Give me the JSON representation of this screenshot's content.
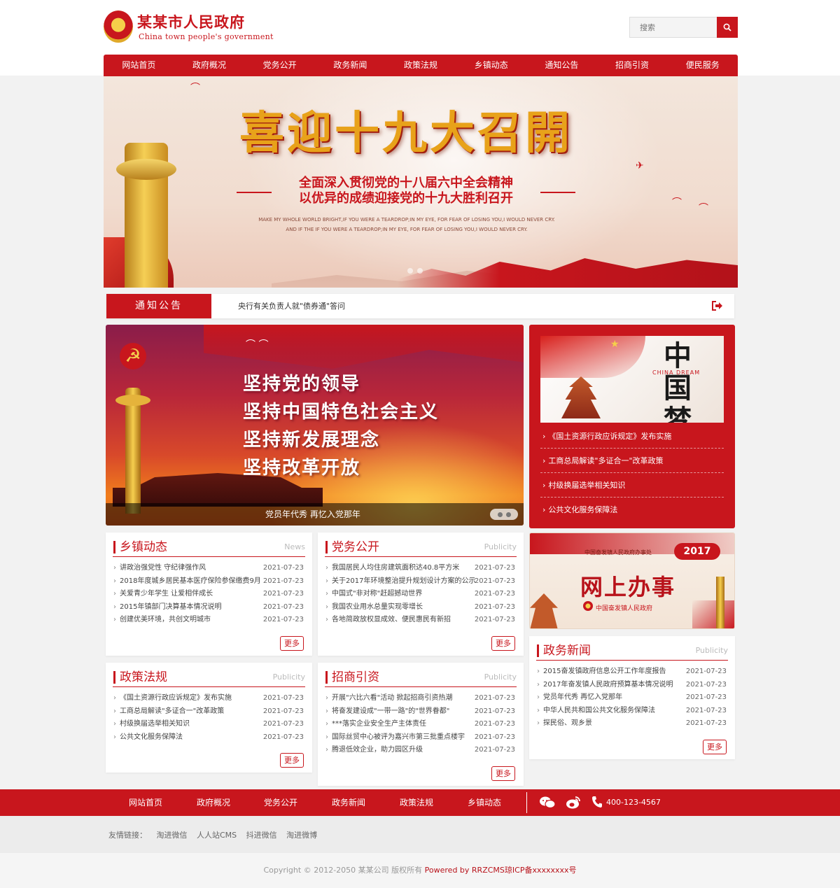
{
  "header": {
    "title": "某某市人民政府",
    "subtitle": "China town people's government",
    "search_placeholder": "搜索"
  },
  "nav": [
    "网站首页",
    "政府概况",
    "党务公开",
    "政务新闻",
    "政策法规",
    "乡镇动态",
    "通知公告",
    "招商引资",
    "便民服务"
  ],
  "banner": {
    "title": "喜迎十九大召開",
    "line1": "全面深入贯彻党的十八届六中全会精神",
    "line2": "以优异的成绩迎接党的十九大胜利召开",
    "en1": "MAKE MY WHOLE WORLD BRIGHT,IF YOU WERE A TEARDROP;IN MY EYE, FOR FEAR OF LOSING YOU,I WOULD NEVER CRY.",
    "en2": "AND IF THE IF YOU WERE A TEARDROP;IN MY EYE, FOR FEAR OF LOSING YOU,I WOULD NEVER CRY."
  },
  "notice": {
    "label": "通知公告",
    "text": "央行有关负责人就\"债券通\"答问"
  },
  "slider": {
    "slogans": [
      "坚持党的领导",
      "坚持中国特色社会主义",
      "坚持新发展理念",
      "坚持改革开放"
    ],
    "caption": "党员年代秀 再忆入党那年"
  },
  "right_box": {
    "image_text": "中国梦",
    "image_en": "CHINA DREAM",
    "items": [
      "《国土资源行政应诉规定》发布实施",
      "工商总局解读\"多证合一\"改革政策",
      "村级换届选举相关知识",
      "公共文化服务保障法"
    ]
  },
  "online": {
    "org": "中国奋发镇人民政府办事处",
    "year": "2017",
    "title": "网上办事",
    "gov": "中国奋发镇人民政府"
  },
  "boxes": {
    "township": {
      "title": "乡镇动态",
      "en": "News",
      "more": "更多",
      "items": [
        {
          "t": "讲政治强党性 守纪律强作风",
          "d": "2021-07-23"
        },
        {
          "t": "2018年度城乡居民基本医疗保险参保缴费9月",
          "d": "2021-07-23"
        },
        {
          "t": "关爱青少年学生 让爱相伴成长",
          "d": "2021-07-23"
        },
        {
          "t": "2015年镇部门决算基本情况说明",
          "d": "2021-07-23"
        },
        {
          "t": "创建优美环境，共创文明城市",
          "d": "2021-07-23"
        }
      ]
    },
    "party": {
      "title": "党务公开",
      "en": "Publicity",
      "more": "更多",
      "items": [
        {
          "t": "我国居民人均住房建筑面积达40.8平方米",
          "d": "2021-07-23"
        },
        {
          "t": "关于2017年环境整治提升规划设计方案的公示",
          "d": "2021-07-23"
        },
        {
          "t": "中国式\"非对称\"赶超撼动世界",
          "d": "2021-07-23"
        },
        {
          "t": "我国农业用水总量实现零增长",
          "d": "2021-07-23"
        },
        {
          "t": "各地简政放权显成效、便民惠民有新招",
          "d": "2021-07-23"
        }
      ]
    },
    "policy": {
      "title": "政策法规",
      "en": "Publicity",
      "more": "更多",
      "items": [
        {
          "t": "《国土资源行政应诉规定》发布实施",
          "d": "2021-07-23"
        },
        {
          "t": "工商总局解读\"多证合一\"改革政策",
          "d": "2021-07-23"
        },
        {
          "t": "村级换届选举相关知识",
          "d": "2021-07-23"
        },
        {
          "t": "公共文化服务保障法",
          "d": "2021-07-23"
        }
      ]
    },
    "invest": {
      "title": "招商引资",
      "en": "Publicity",
      "more": "更多",
      "items": [
        {
          "t": "开展\"六比六看\"活动 掀起招商引资热潮",
          "d": "2021-07-23"
        },
        {
          "t": "将奋发建设成\"一带一路\"的\"世界眷都\"",
          "d": "2021-07-23"
        },
        {
          "t": "***落实企业安全生产主体责任",
          "d": "2021-07-23"
        },
        {
          "t": "国际丝贸中心被评为嘉兴市第三批重点楼宇",
          "d": "2021-07-23"
        },
        {
          "t": "腾退低效企业，助力园区升级",
          "d": "2021-07-23"
        }
      ]
    },
    "govnews": {
      "title": "政务新闻",
      "en": "Publicity",
      "more": "更多",
      "items": [
        {
          "t": "2015奋发镇政府信息公开工作年度报告",
          "d": "2021-07-23"
        },
        {
          "t": "2017年奋发镇人民政府预算基本情况说明",
          "d": "2021-07-23"
        },
        {
          "t": "党员年代秀 再忆入党那年",
          "d": "2021-07-23"
        },
        {
          "t": "中华人民共和国公共文化服务保障法",
          "d": "2021-07-23"
        },
        {
          "t": "探民俗、观乡景",
          "d": "2021-07-23"
        }
      ]
    }
  },
  "footer": {
    "nav": [
      "网站首页",
      "政府概况",
      "党务公开",
      "政务新闻",
      "政策法规",
      "乡镇动态"
    ],
    "phone": "400-123-4567",
    "links_label": "友情链接：",
    "links": [
      "淘进微信",
      "人人站CMS",
      "抖进微信",
      "淘进微博"
    ],
    "copyright": "Copyright © 2012-2050 某某公司 版权所有",
    "powered": "Powered by RRZCMS",
    "icp": "琼ICP备xxxxxxxx号"
  },
  "colors": {
    "primary": "#c8161d",
    "bg": "#f2f2f2"
  }
}
